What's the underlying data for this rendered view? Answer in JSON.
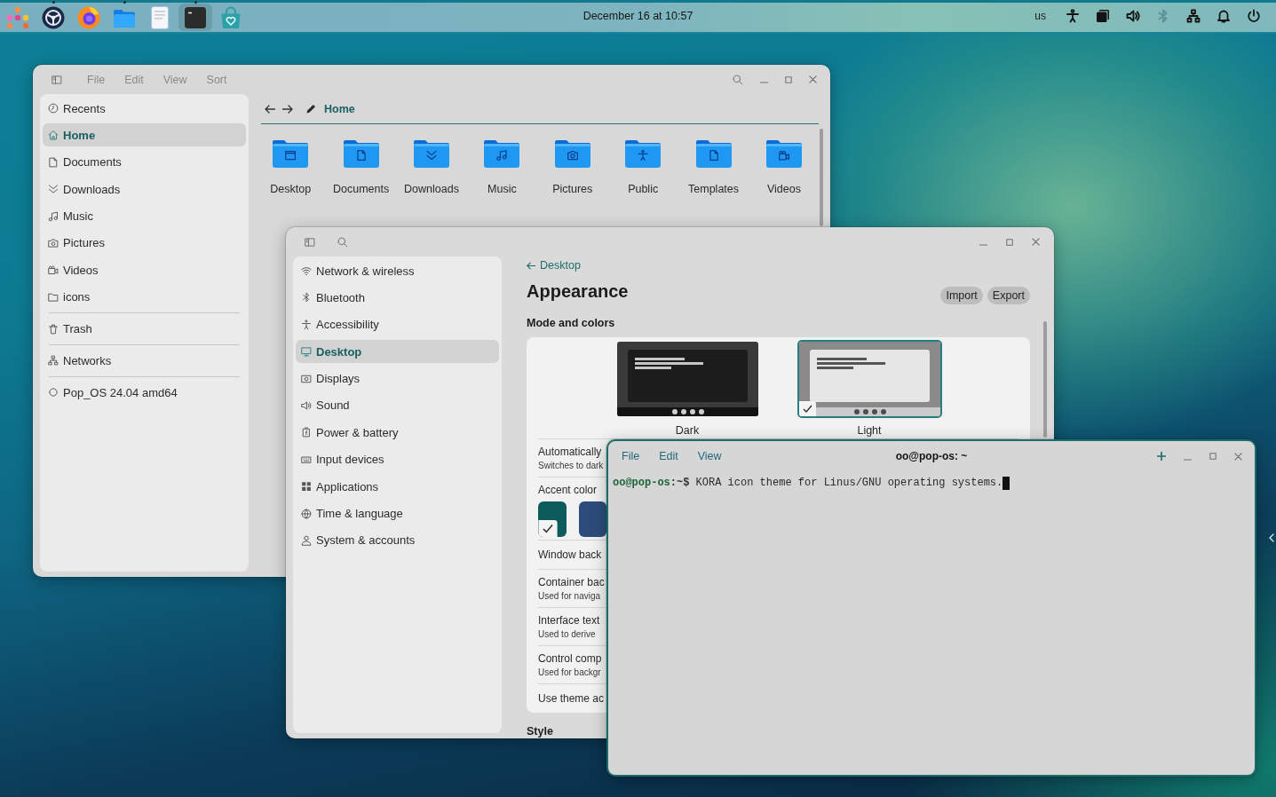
{
  "top_bar": {
    "dock": [
      {
        "kind": "apps",
        "running": false,
        "focused": false
      },
      {
        "kind": "wheel",
        "running": true,
        "focused": false
      },
      {
        "kind": "browser",
        "running": false,
        "focused": false
      },
      {
        "kind": "files",
        "running": true,
        "focused": false
      },
      {
        "kind": "editor",
        "running": false,
        "focused": false
      },
      {
        "kind": "terminal",
        "running": true,
        "focused": true
      },
      {
        "kind": "store",
        "running": false,
        "focused": false
      }
    ],
    "clock": "December 16 at 10:57",
    "keyboard_layout": "us",
    "tray": [
      {
        "kind": "accessibility",
        "dimmed": false
      },
      {
        "kind": "workspaces",
        "dimmed": false
      },
      {
        "kind": "volume",
        "dimmed": false
      },
      {
        "kind": "bluetooth",
        "dimmed": true
      },
      {
        "kind": "network",
        "dimmed": false
      },
      {
        "kind": "notifications",
        "dimmed": false
      },
      {
        "kind": "power",
        "dimmed": false
      }
    ]
  },
  "file_manager": {
    "menu": [
      "File",
      "Edit",
      "View",
      "Sort"
    ],
    "sidebar": [
      {
        "items": [
          {
            "kind": "recent",
            "label": "Recents",
            "selected": false
          },
          {
            "kind": "home",
            "label": "Home",
            "selected": true
          },
          {
            "kind": "document",
            "label": "Documents",
            "selected": false
          },
          {
            "kind": "download",
            "label": "Downloads",
            "selected": false
          },
          {
            "kind": "music",
            "label": "Music",
            "selected": false
          },
          {
            "kind": "picture",
            "label": "Pictures",
            "selected": false
          },
          {
            "kind": "video",
            "label": "Videos",
            "selected": false
          },
          {
            "kind": "folder",
            "label": "icons",
            "selected": false
          }
        ]
      },
      {
        "items": [
          {
            "kind": "trash",
            "label": "Trash",
            "selected": false
          }
        ]
      },
      {
        "items": [
          {
            "kind": "network",
            "label": "Networks",
            "selected": false
          }
        ]
      },
      {
        "items": [
          {
            "kind": "disc",
            "label": "Pop_OS 24.04 amd64",
            "selected": false
          }
        ]
      }
    ],
    "location": "Home",
    "folders": [
      {
        "kind": "desktop",
        "label": "Desktop"
      },
      {
        "kind": "documents",
        "label": "Documents"
      },
      {
        "kind": "downloads",
        "label": "Downloads"
      },
      {
        "kind": "music",
        "label": "Music"
      },
      {
        "kind": "pictures",
        "label": "Pictures"
      },
      {
        "kind": "public",
        "label": "Public"
      },
      {
        "kind": "templates",
        "label": "Templates"
      },
      {
        "kind": "videos",
        "label": "Videos"
      }
    ]
  },
  "settings": {
    "sidebar": [
      {
        "kind": "wifi",
        "label": "Network & wireless",
        "selected": false
      },
      {
        "kind": "bluetooth",
        "label": "Bluetooth",
        "selected": false
      },
      {
        "kind": "accessibility",
        "label": "Accessibility",
        "selected": false
      },
      {
        "kind": "desktop",
        "label": "Desktop",
        "selected": true
      },
      {
        "kind": "displays",
        "label": "Displays",
        "selected": false
      },
      {
        "kind": "sound",
        "label": "Sound",
        "selected": false
      },
      {
        "kind": "battery",
        "label": "Power & battery",
        "selected": false
      },
      {
        "kind": "input",
        "label": "Input devices",
        "selected": false
      },
      {
        "kind": "apps",
        "label": "Applications",
        "selected": false
      },
      {
        "kind": "time",
        "label": "Time & language",
        "selected": false
      },
      {
        "kind": "user",
        "label": "System & accounts",
        "selected": false
      }
    ],
    "back_link": "Desktop",
    "title": "Appearance",
    "buttons": [
      "Import",
      "Export"
    ],
    "section": "Mode and colors",
    "themes": [
      {
        "kind": "dark",
        "label": "Dark",
        "selected": false
      },
      {
        "kind": "light",
        "label": "Light",
        "selected": true
      }
    ],
    "rows": [
      {
        "kind": "text",
        "title": "Automatically",
        "subtitle": "Switches to dark"
      },
      {
        "kind": "accent",
        "title": "Accent color",
        "swatches": [
          {
            "color": "#0e5b5d",
            "selected": true
          },
          {
            "color": "#2c4d7c",
            "selected": false
          }
        ]
      },
      {
        "kind": "text",
        "title": "Window back"
      },
      {
        "kind": "text",
        "title": "Container bac",
        "subtitle": "Used for naviga"
      },
      {
        "kind": "text",
        "title": "Interface text",
        "subtitle": "Used to derive"
      },
      {
        "kind": "text",
        "title": "Control comp",
        "subtitle": "Used for backgr"
      },
      {
        "kind": "text",
        "title": "Use theme ac"
      }
    ],
    "next_section": "Style"
  },
  "terminal": {
    "menu": [
      "File",
      "Edit",
      "View"
    ],
    "title": "oo@pop-os: ~",
    "lines": [
      {
        "user_host": "oo@pop-os",
        "path": ":~$",
        "command": "KORA icon theme for Linus/GNU operating systems.",
        "cursor": true
      }
    ]
  }
}
